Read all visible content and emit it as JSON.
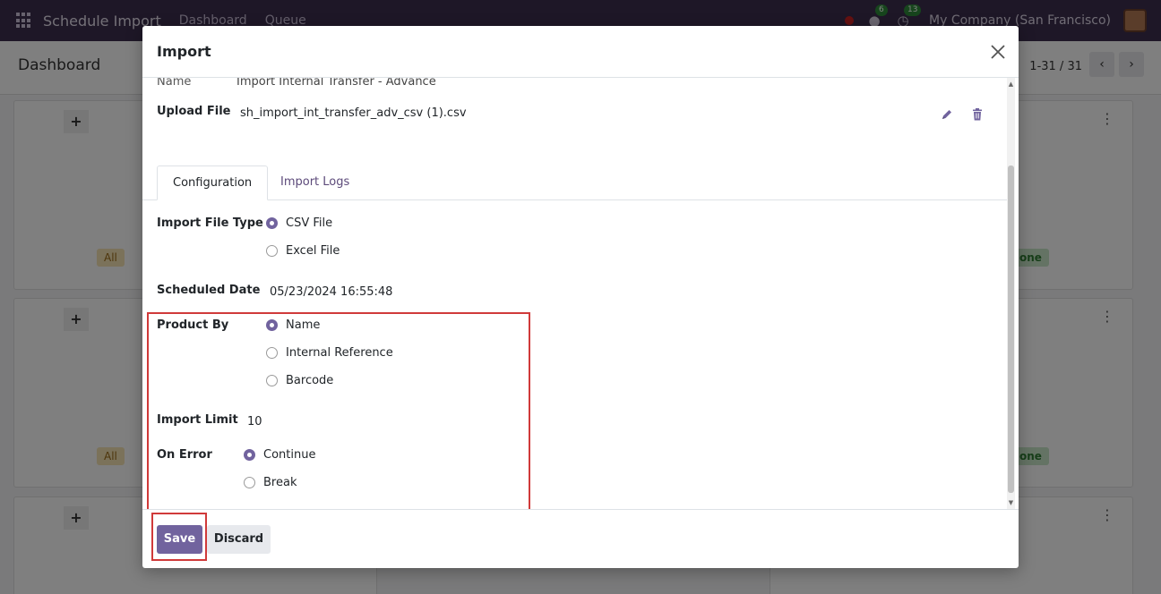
{
  "navbar": {
    "app_name": "Schedule Import",
    "menu": [
      "Dashboard",
      "Queue"
    ],
    "chat_count": "6",
    "activity_count": "13",
    "company": "My Company (San Francisco)"
  },
  "control": {
    "title": "Dashboard",
    "pager": "1-31 / 31"
  },
  "background": {
    "tag_all": "All",
    "tag_done": "one"
  },
  "modal": {
    "title": "Import",
    "name_label": "Name",
    "name_value": "Import Internal Transfer - Advance",
    "upload_label": "Upload File",
    "upload_value": "sh_import_int_transfer_adv_csv (1).csv",
    "tabs": [
      {
        "label": "Configuration"
      },
      {
        "label": "Import Logs"
      }
    ],
    "file_type": {
      "label": "Import File Type",
      "options": [
        "CSV File",
        "Excel File"
      ],
      "selected": "CSV File"
    },
    "scheduled_date": {
      "label": "Scheduled Date",
      "value": "05/23/2024 16:55:48"
    },
    "product_by": {
      "label": "Product By",
      "options": [
        "Name",
        "Internal Reference",
        "Barcode"
      ],
      "selected": "Name"
    },
    "import_limit": {
      "label": "Import Limit",
      "value": "10"
    },
    "on_error": {
      "label": "On Error",
      "options": [
        "Continue",
        "Break"
      ],
      "selected": "Continue"
    },
    "footer": {
      "save_label": "Save",
      "discard_label": "Discard"
    },
    "accent_color": "#71639e",
    "highlight_color": "#d03a3a"
  }
}
